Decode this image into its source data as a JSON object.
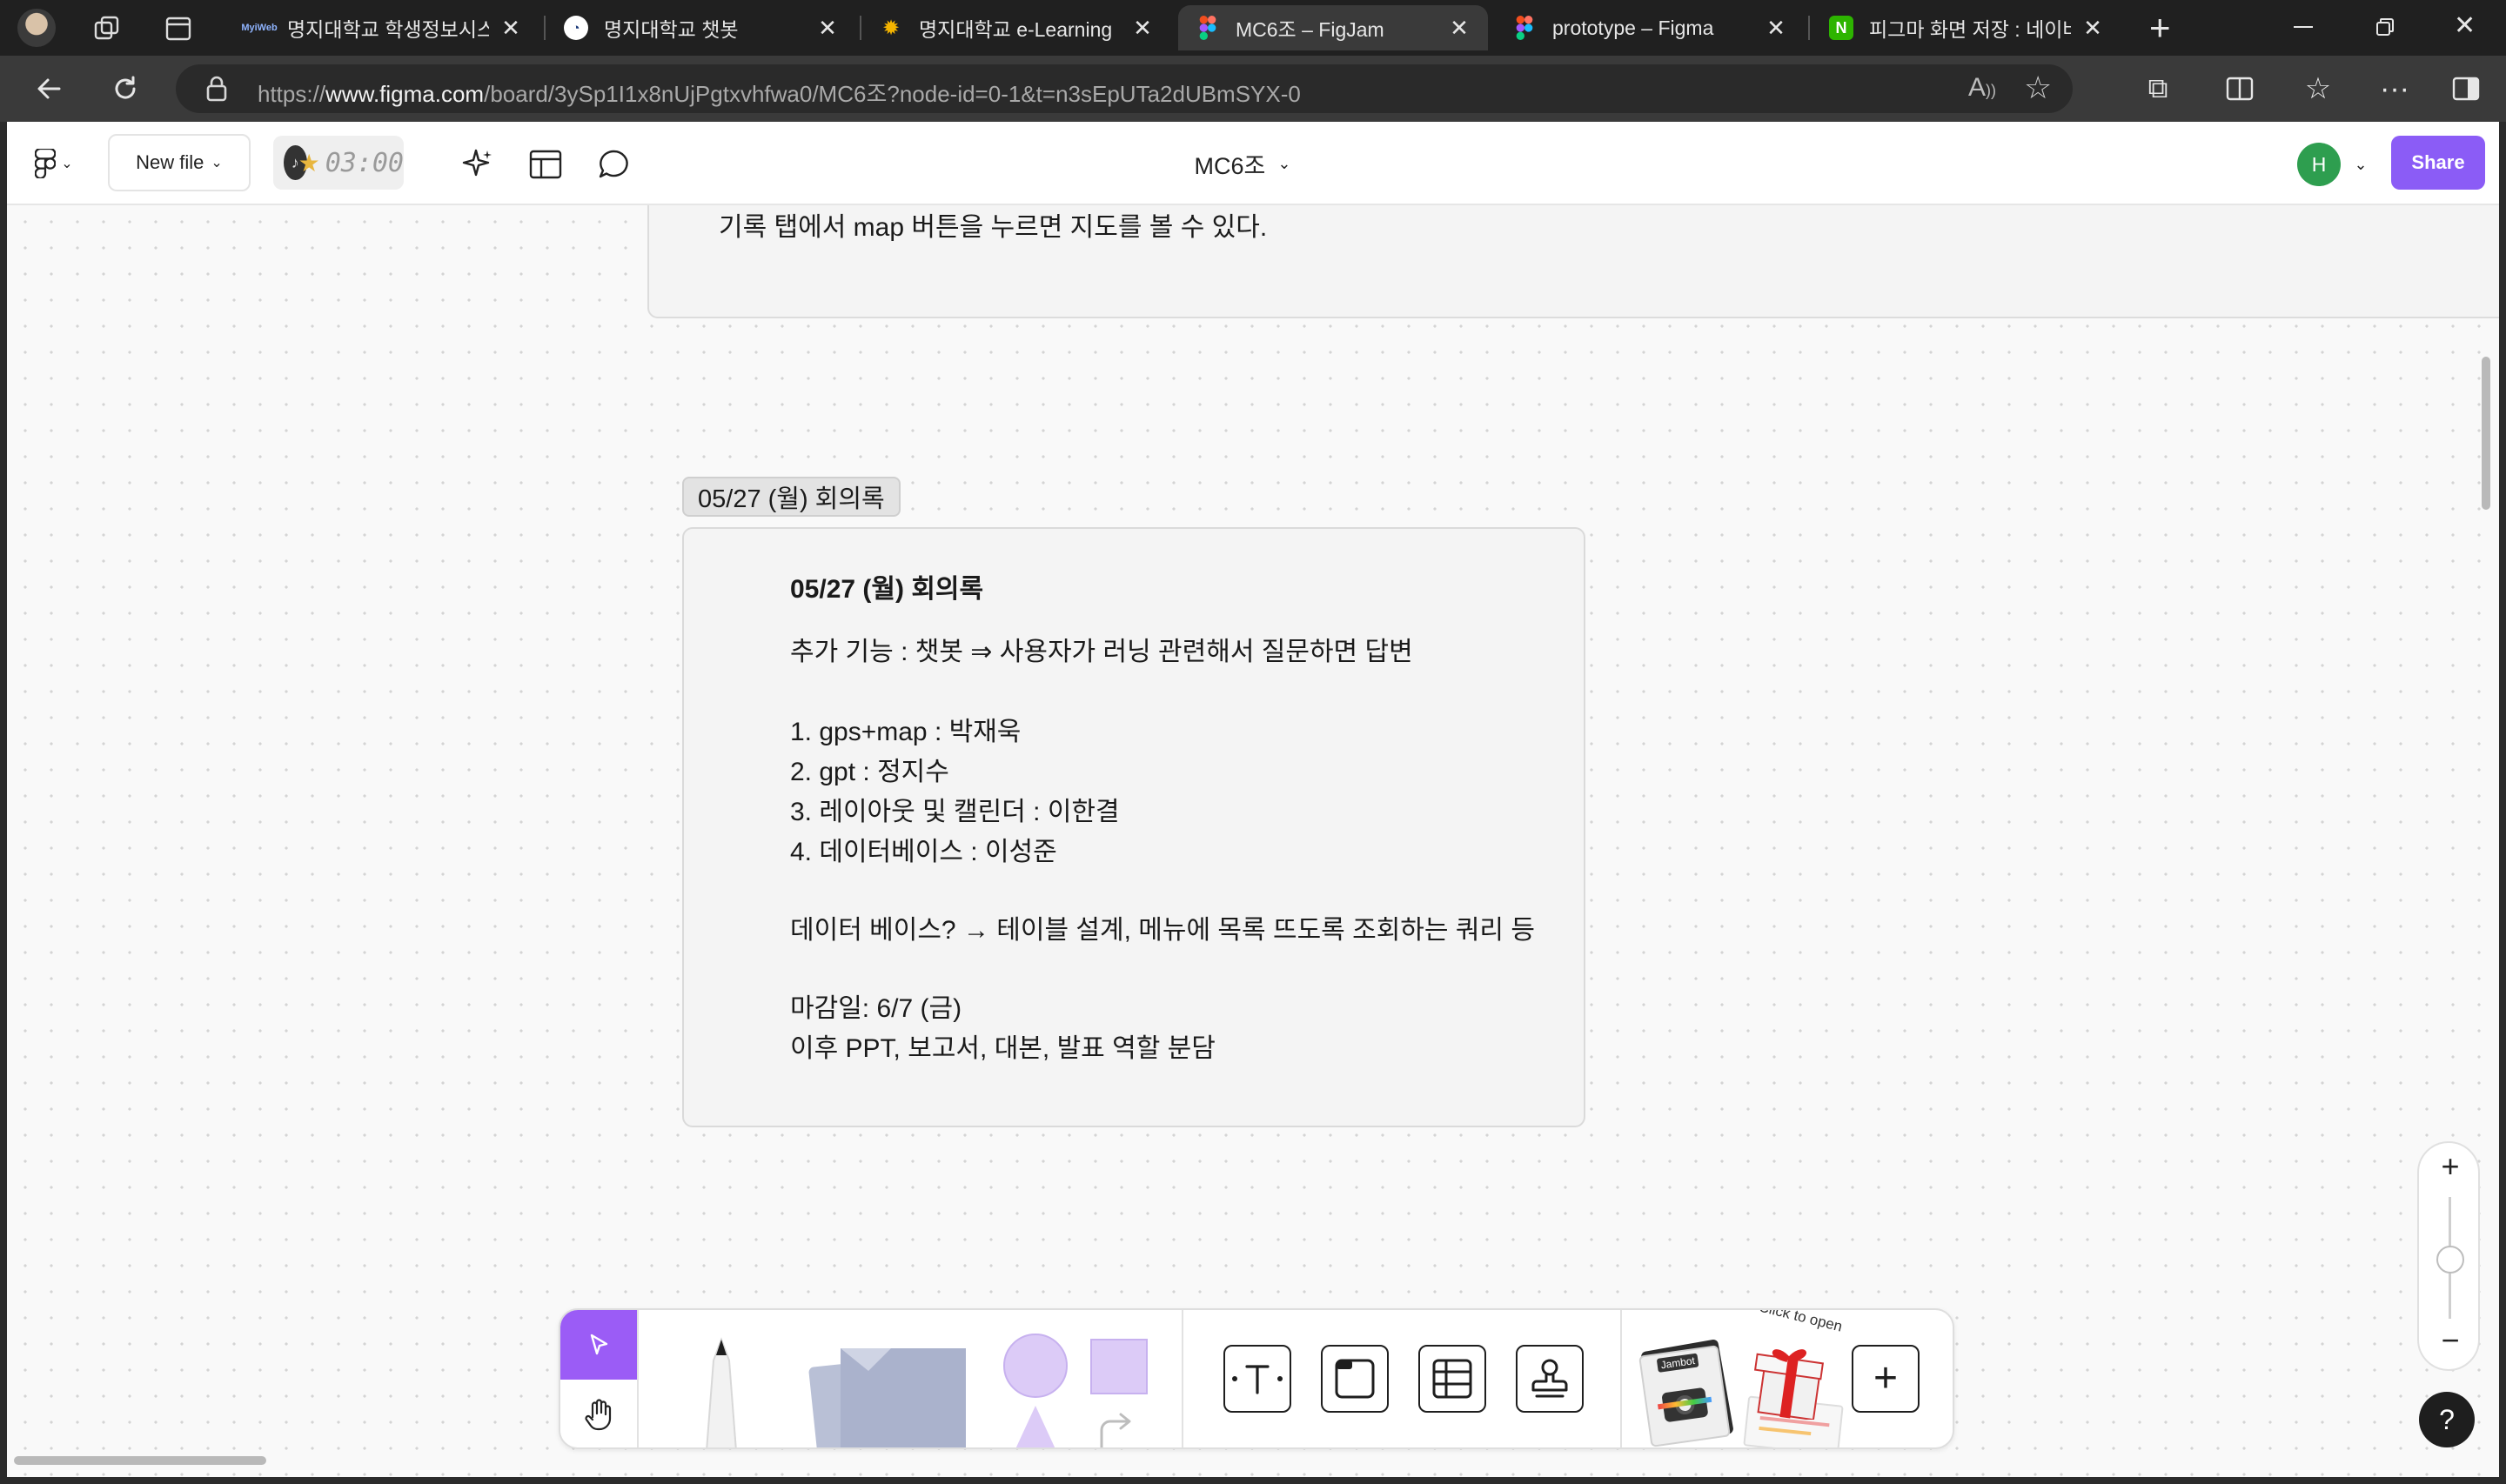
{
  "browser": {
    "tabs": [
      {
        "title": "명지대학교 학생정보시스템",
        "favicon": "myiweb-icon",
        "favicon_color": "#1b3a7a"
      },
      {
        "title": "명지대학교 챗봇",
        "favicon": "chatbot-icon",
        "favicon_color": "#ffffff"
      },
      {
        "title": "명지대학교 e-Learning",
        "favicon": "elearning-icon",
        "favicon_color": "#f4b400"
      },
      {
        "title": "MC6조 – FigJam",
        "favicon": "figma-icon",
        "favicon_color": "#a259ff",
        "active": true
      },
      {
        "title": "prototype – Figma",
        "favicon": "figma-icon",
        "favicon_color": "#f24e1e"
      },
      {
        "title": "피그마 화면 저장 : 네이버",
        "favicon": "naver-icon",
        "favicon_color": "#2db400"
      }
    ],
    "new_tab_label": "+",
    "url_prefix": "https://",
    "url_host": "www.figma.com",
    "url_path": "/board/3ySp1I1x8nUjPgtxvhfwa0/MC6조?node-id=0-1&t=n3sEpUTa2dUBmSYX-0"
  },
  "figjam": {
    "new_file_label": "New file",
    "timer": "03:00",
    "file_name": "MC6조",
    "avatar_initial": "H",
    "share_label": "Share",
    "accent_color": "#8b5cf6"
  },
  "canvas": {
    "previous_note_text": "기록 탭에서 map 버튼을 누르면 지도를 볼 수 있다.",
    "section_label": "05/27 (월) 회의록",
    "note": {
      "title": "05/27 (월) 회의록",
      "feature": "추가 기능 : 챗봇 ⇒ 사용자가 러닝 관련해서 질문하면 답변",
      "tasks": [
        "1. gps+map : 박재욱",
        "2. gpt : 정지수",
        "3. 레이아웃 및 캘린더 : 이한결",
        "4. 데이터베이스 : 이성준"
      ],
      "database": "데이터 베이스? → 테이블 설계, 메뉴에 목록 뜨도록 조회하는 쿼리 등",
      "deadline": "마감일: 6/7 (금)",
      "after": "이후 PPT, 보고서, 대본, 발표 역할 분담"
    }
  },
  "toolbar": {
    "click_to_open": "Click to open",
    "jambot_label": "Jambot",
    "add_label": "+"
  },
  "controls": {
    "zoom_in": "+",
    "zoom_out": "−",
    "help": "?"
  }
}
